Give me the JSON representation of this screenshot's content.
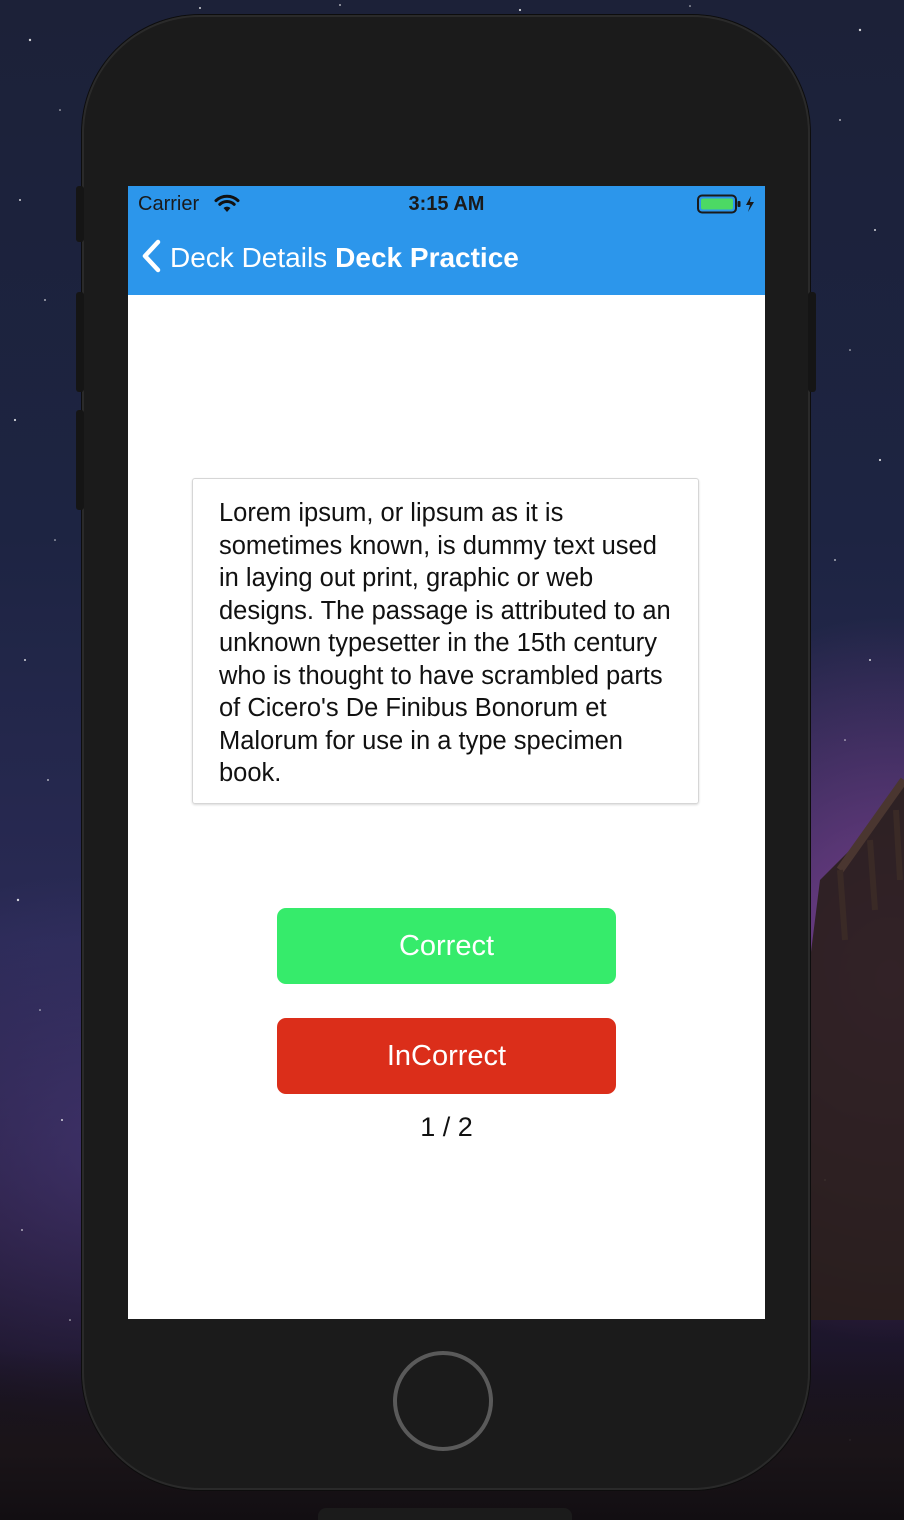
{
  "status_bar": {
    "carrier": "Carrier",
    "time": "3:15 AM",
    "battery_color": "#4cd964"
  },
  "nav": {
    "back_label": "Deck Details",
    "title": "Deck Practice",
    "bar_color": "#2c96eb"
  },
  "card": {
    "text": "Lorem ipsum, or lipsum as it is sometimes known, is dummy text used in laying out print, graphic or web designs. The passage is attributed to an unknown typesetter in the 15th century who is thought to have scrambled parts of Cicero's De Finibus Bonorum et Malorum for use in a type specimen book."
  },
  "actions": {
    "correct_label": "Correct",
    "correct_color": "#36eb6b",
    "incorrect_label": "InCorrect",
    "incorrect_color": "#db2e1a"
  },
  "progress": {
    "text": "1 / 2",
    "current": 1,
    "total": 2
  },
  "icons": [
    "wifi-icon",
    "battery-icon",
    "chevron-left-icon",
    "home-button"
  ]
}
